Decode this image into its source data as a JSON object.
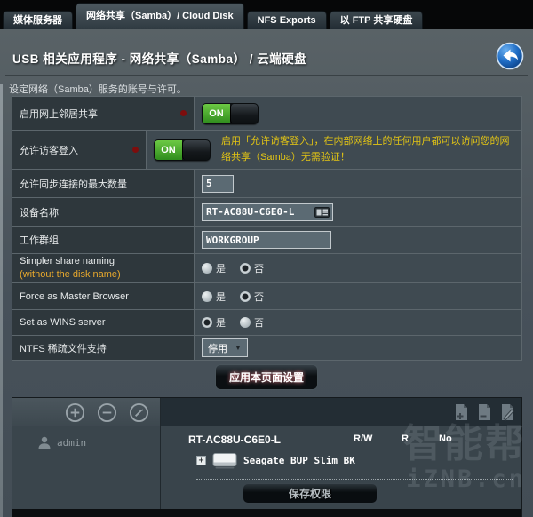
{
  "tabs": {
    "items": [
      {
        "label": "媒体服务器"
      },
      {
        "label": "网络共享（Samba）/ Cloud Disk"
      },
      {
        "label": "NFS Exports"
      },
      {
        "label": "以 FTP 共享硬盘"
      }
    ]
  },
  "header": {
    "title": "USB 相关应用程序 - 网络共享（Samba） / 云端硬盘",
    "description": "设定网络（Samba）服务的账号与许可。"
  },
  "form": {
    "radio_yes": "是",
    "radio_no": "否",
    "rows": {
      "neighborhood": {
        "label": "启用网上邻居共享",
        "required": true,
        "state": "ON"
      },
      "guest_login": {
        "label": "允许访客登入",
        "required": true,
        "state": "ON",
        "note": "启用「允许访客登入」，在内部网络上的任何用户都可以访问您的网络共享（Samba）无需验证！"
      },
      "max_connections": {
        "label": "允许同步连接的最大数量",
        "value": "5"
      },
      "device_name": {
        "label": "设备名称",
        "value": "RT-AC88U-C6E0-L"
      },
      "workgroup": {
        "label": "工作群组",
        "value": "WORKGROUP"
      },
      "simpler_naming": {
        "label": "Simpler share naming",
        "sublabel": "(without the disk name)",
        "selected": "否"
      },
      "master_browser": {
        "label": "Force as Master Browser",
        "selected": "否"
      },
      "wins_server": {
        "label": "Set as WINS server",
        "selected": "是"
      },
      "ntfs_sparse": {
        "label": "NTFS 稀疏文件支持",
        "value": "停用"
      }
    },
    "apply_button": "应用本页面设置"
  },
  "permissions": {
    "user": "admin",
    "device": "RT-AC88U-C6E0-L",
    "columns": [
      "R/W",
      "R",
      "No"
    ],
    "drive": "Seagate BUP Slim BK",
    "save_button": "保存权限"
  },
  "watermark": {
    "line1": "智能帮",
    "line2": "iZNB.cn"
  },
  "colors": {
    "toggle_on": "#3f9e26",
    "accent_warning": "#e3c514",
    "required_dot": "#7d0d0d",
    "back_icon_blue": "#1565c0"
  }
}
